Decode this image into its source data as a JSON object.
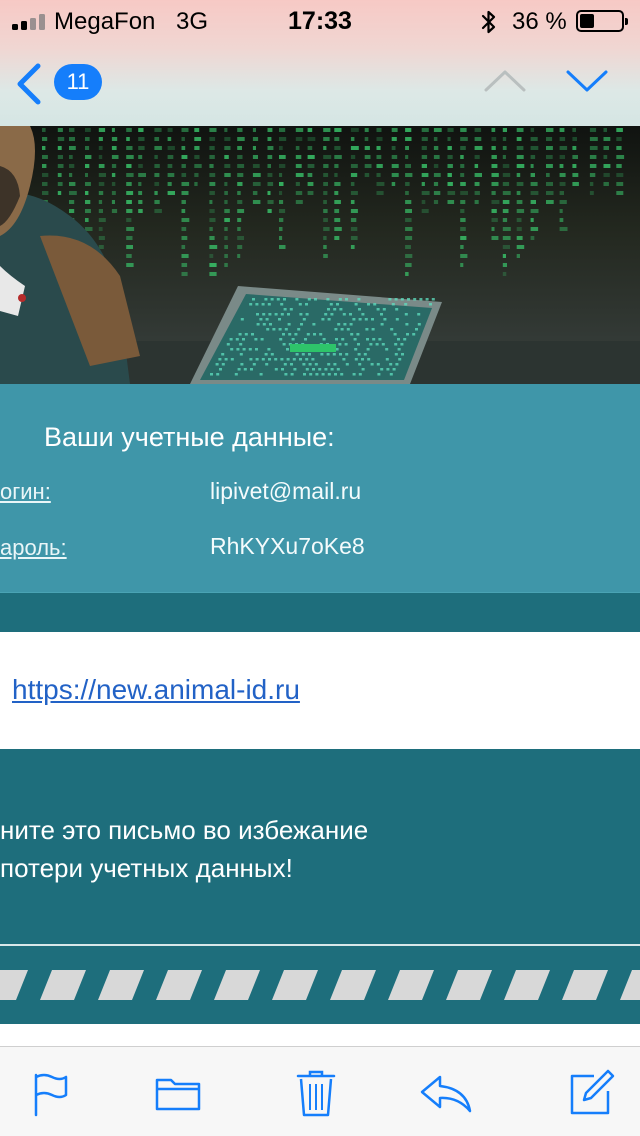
{
  "status_bar": {
    "carrier": "MegaFon",
    "network": "3G",
    "time": "17:33",
    "battery_percent": "36 %",
    "battery_level": 0.36,
    "icons": [
      "signal-icon",
      "bluetooth-icon",
      "battery-icon"
    ]
  },
  "nav_bar": {
    "unread_count": "11",
    "icons": [
      "back-chevron-icon",
      "chevron-up-icon",
      "chevron-down-icon"
    ],
    "accent_color": "#157efb"
  },
  "email": {
    "credentials_title": "Ваши учетные данные:",
    "login_label": "огин:",
    "login_value": "lipivet@mail.ru",
    "password_label": "ароль:",
    "password_value": "RhKYXu7oKe8",
    "site_link": "https://new.animal-id.ru",
    "warning_line1": "ните это письмо во избежание",
    "warning_line2": "потери учетных данных!",
    "colors": {
      "credentials_bg": "#3f96a9",
      "dark_band": "#1e6e7c",
      "link": "#2262c6"
    }
  },
  "toolbar": {
    "icons": [
      "flag-icon",
      "folder-icon",
      "trash-icon",
      "reply-icon",
      "compose-icon"
    ],
    "icon_color": "#157efb"
  }
}
